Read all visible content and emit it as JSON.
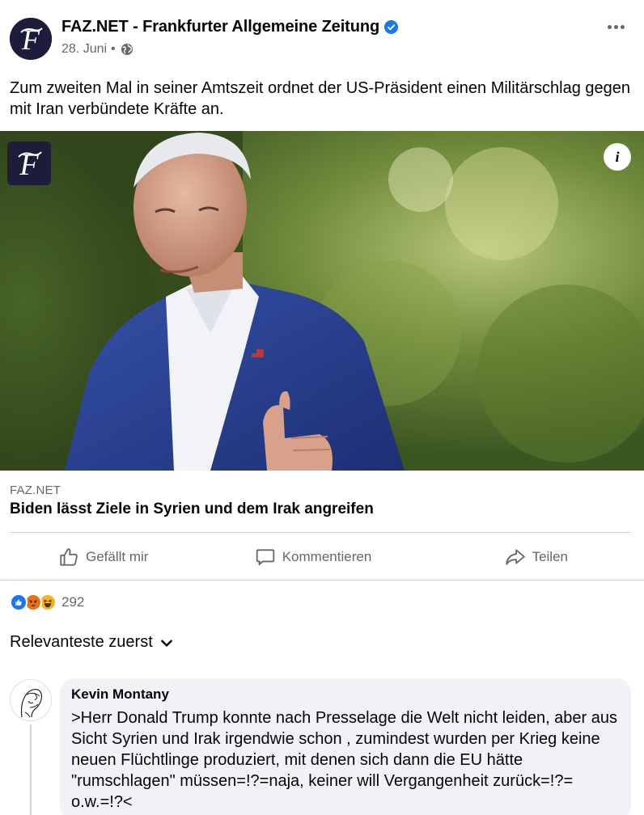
{
  "post": {
    "page_name": "FAZ.NET - Frankfurter Allgemeine Zeitung",
    "date": "28. Juni",
    "separator": "•",
    "text": "Zum zweiten Mal in seiner Amtszeit ordnet der US-Präsident einen Militärschlag gegen mit Iran verbündete Kräfte an.",
    "more_icon": "more-horizontal-icon",
    "privacy_icon": "globe-icon",
    "verified_icon": "verified-badge-icon"
  },
  "hero": {
    "info_label": "i"
  },
  "link": {
    "domain": "FAZ.NET",
    "title": "Biden lässt Ziele in Syrien und dem Irak angreifen"
  },
  "actions": {
    "like_label": "Gefällt mir",
    "comment_label": "Kommentieren",
    "share_label": "Teilen"
  },
  "reactions": {
    "count": "292",
    "types": [
      "like",
      "angry",
      "haha"
    ]
  },
  "comments": {
    "sort_label": "Relevanteste zuerst",
    "items": [
      {
        "author": "Kevin Montany",
        "text": ">Herr Donald Trump konnte nach Presselage die Welt nicht leiden, aber aus Sicht Syrien und Irak irgendwie schon , zumindest wurden per Krieg keine neuen Flüchtlinge produziert, mit denen sich dann die EU hätte \"rumschlagen\" müssen=!?=naja, keiner will Vergangenheit zurück=!?= o.w.=!?<"
      }
    ]
  },
  "colors": {
    "brand_blue": "#1877f2",
    "text_secondary": "#65676b",
    "faz_navy": "#1c1d3b",
    "bubble_bg": "#f0f2f5"
  }
}
